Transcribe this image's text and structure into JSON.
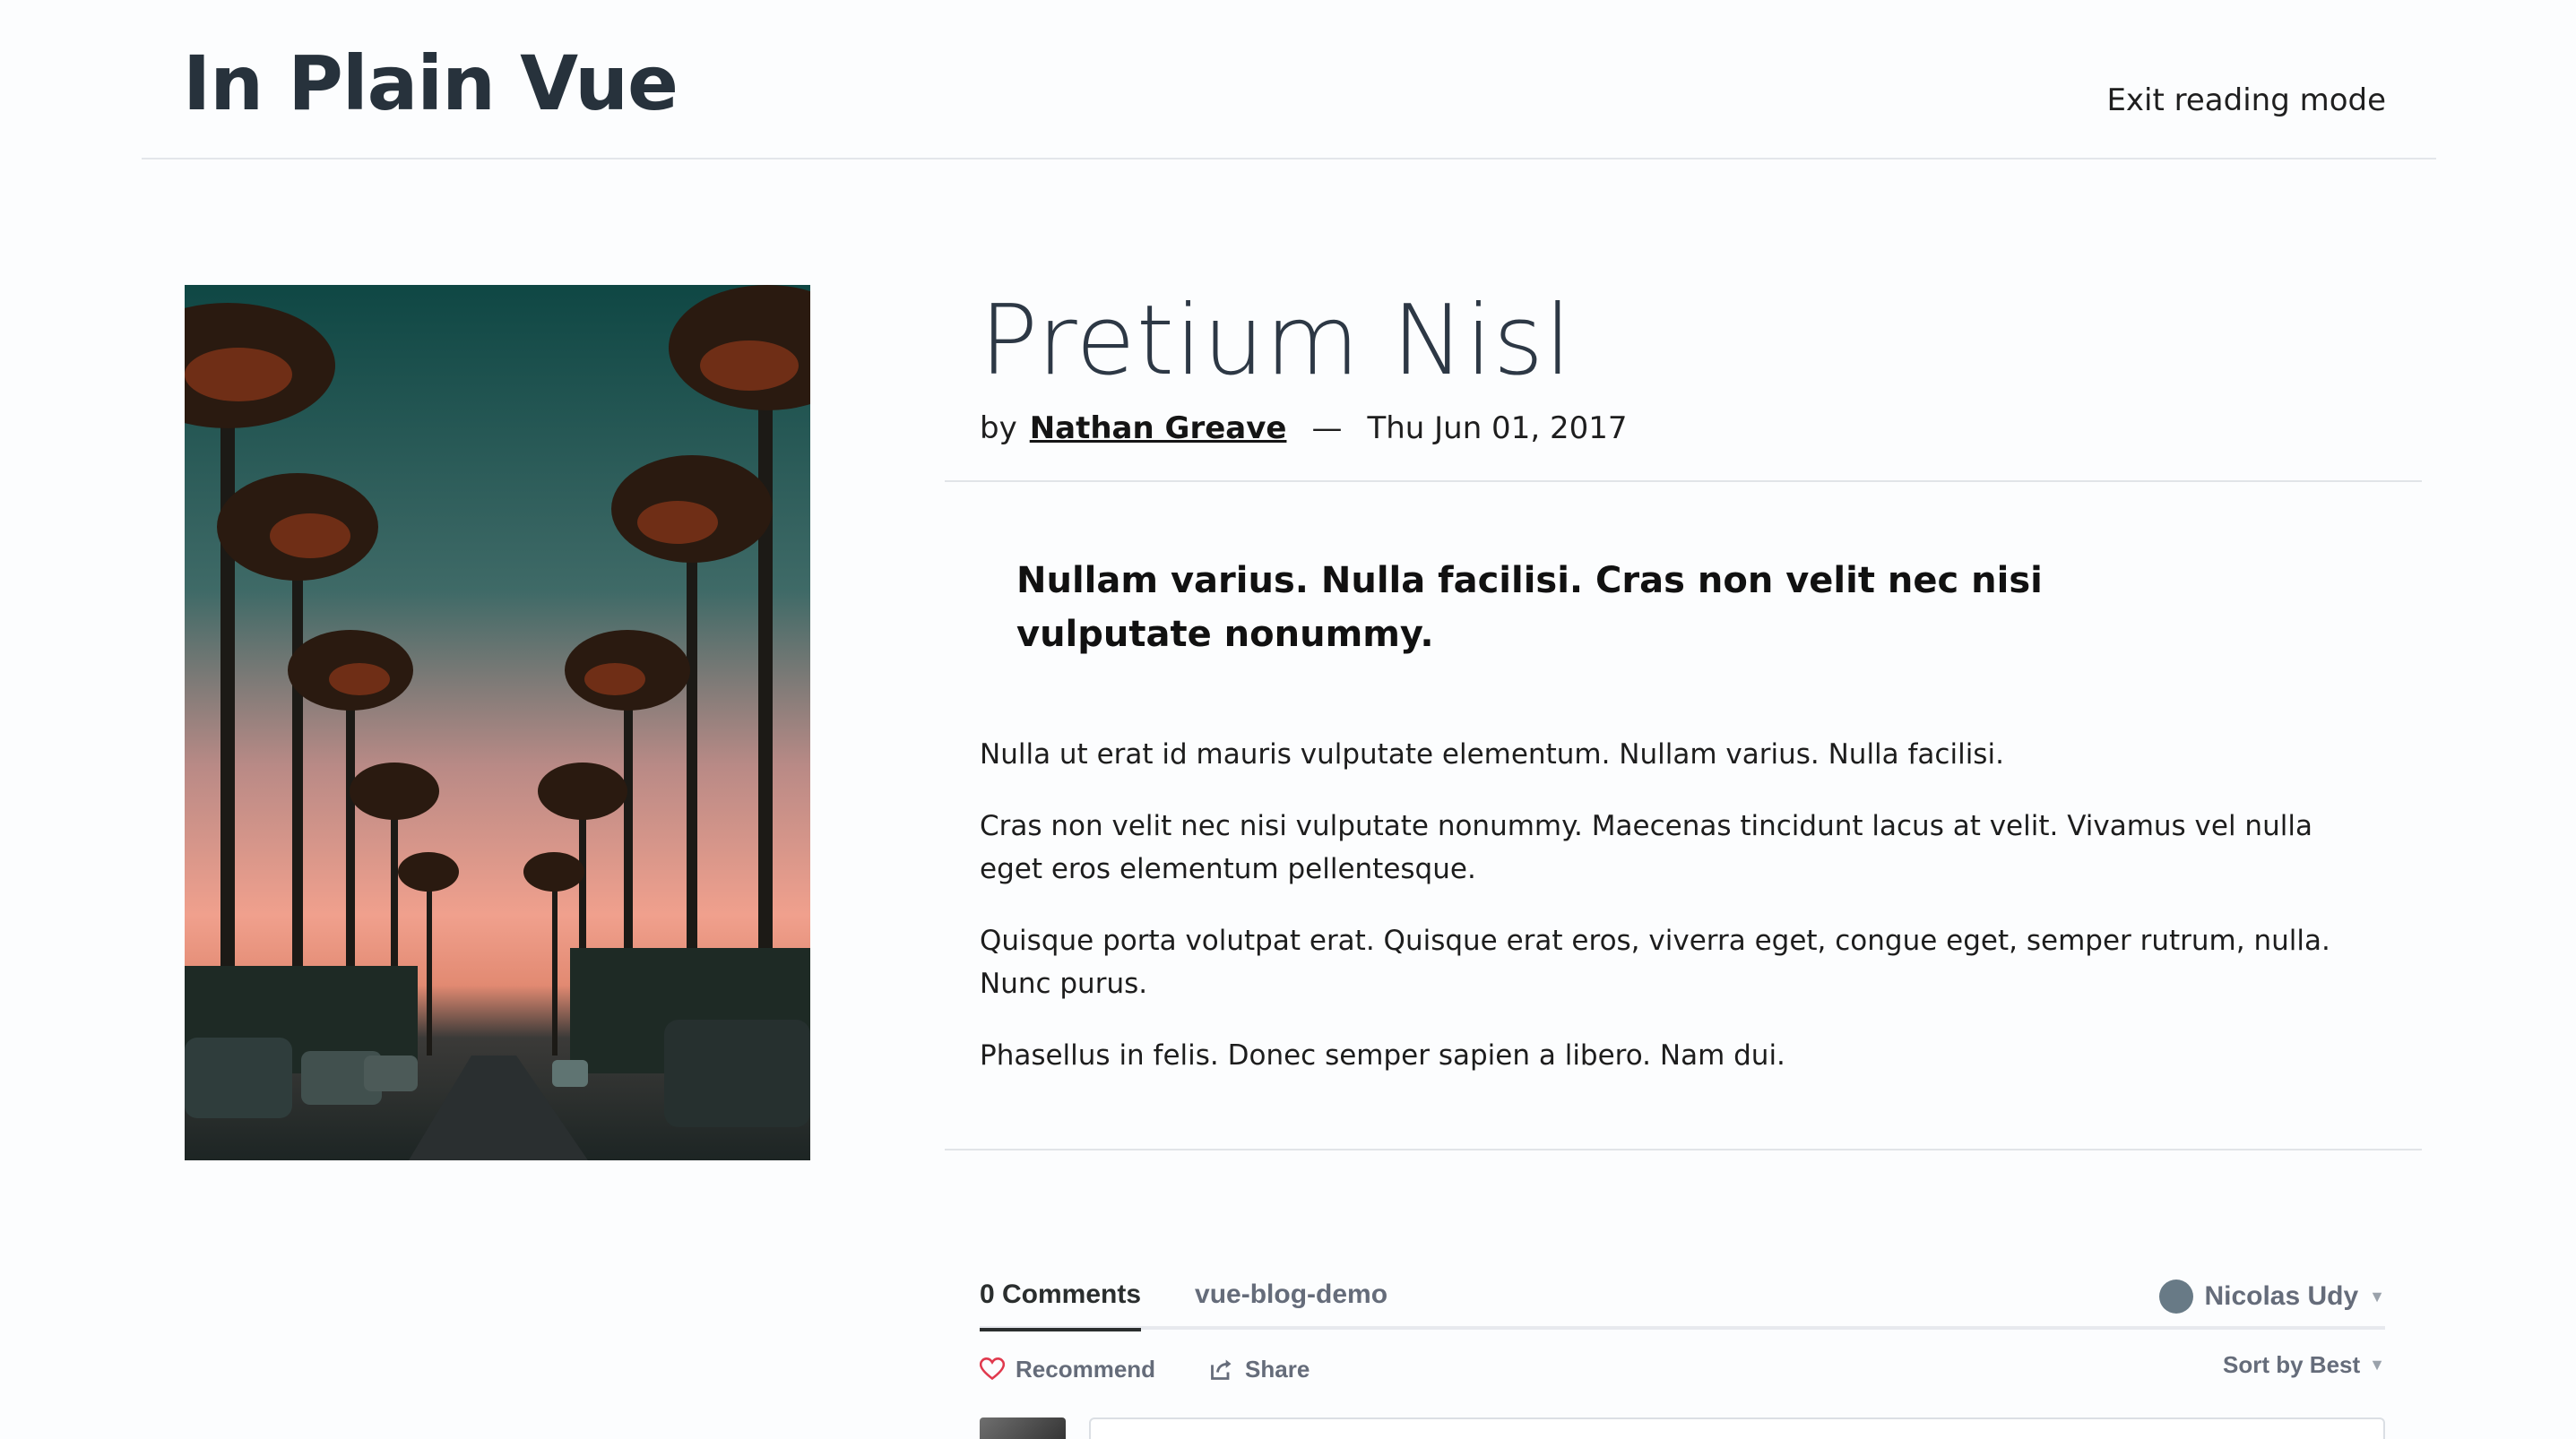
{
  "header": {
    "site_title": "In Plain Vue",
    "exit_label": "Exit reading mode"
  },
  "post": {
    "title": "Pretium Nisl",
    "by_label": "by",
    "author": "Nathan Greave",
    "separator": "—",
    "date": "Thu Jun 01, 2017",
    "lede": "Nullam varius. Nulla facilisi. Cras non velit nec nisi vulputate nonummy.",
    "paragraphs": [
      "Nulla ut erat id mauris vulputate elementum. Nullam varius. Nulla facilisi.",
      "Cras non velit nec nisi vulputate nonummy. Maecenas tincidunt lacus at velit. Vivamus vel nulla eget eros elementum pellentesque.",
      "Quisque porta volutpat erat. Quisque erat eros, viverra eget, congue eget, semper rutrum, nulla. Nunc purus.",
      "Phasellus in felis. Donec semper sapien a libero. Nam dui."
    ]
  },
  "comments": {
    "count_tab": "0 Comments",
    "forum_tab": "vue-blog-demo",
    "user_name": "Nicolas Udy",
    "recommend_label": "Recommend",
    "share_label": "Share",
    "sort_label": "Sort by Best"
  },
  "colors": {
    "title": "#27323c",
    "heart": "#e0394d",
    "muted": "#656c7a"
  }
}
